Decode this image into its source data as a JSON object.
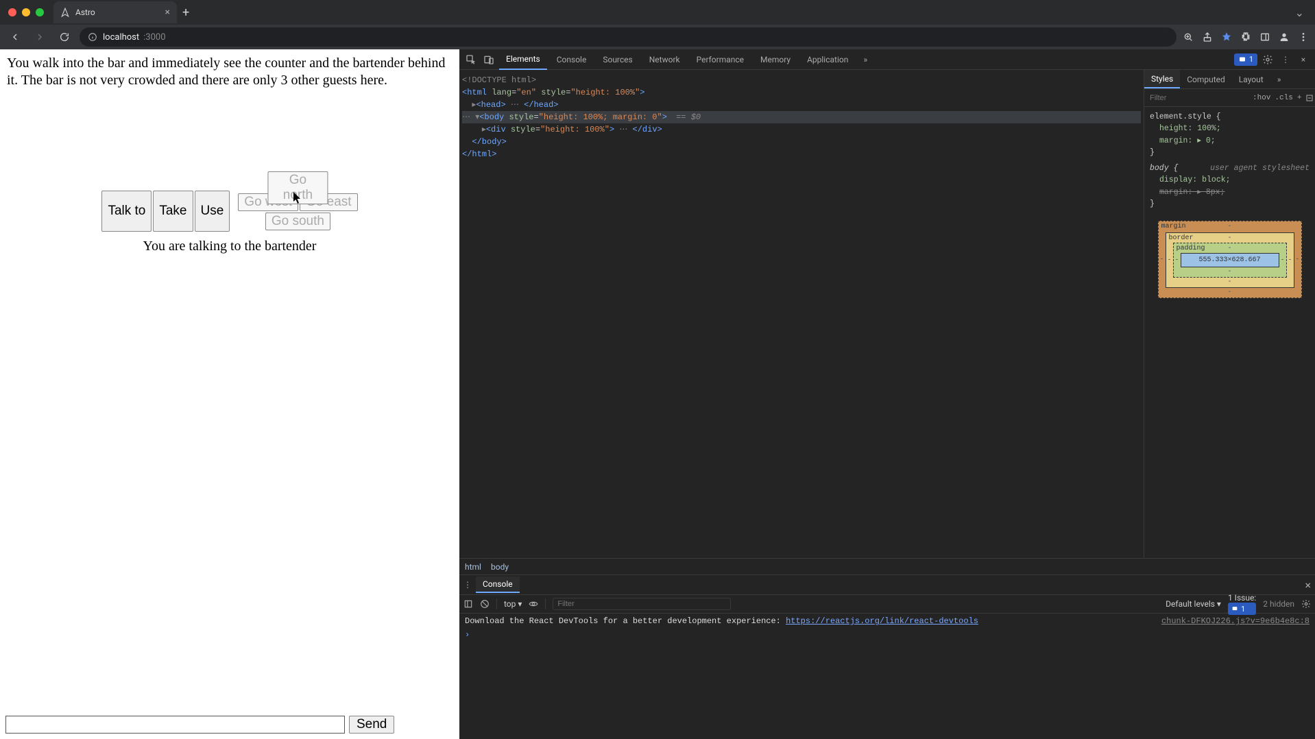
{
  "browser": {
    "tab_title": "Astro",
    "url_host": "localhost",
    "url_rest": ":3000"
  },
  "page": {
    "story_text": "You walk into the bar and immediately see the counter and the bartender behind it. The bar is not very crowded and there are only 3 other guests here.",
    "actions": {
      "talk": "Talk to",
      "take": "Take",
      "use": "Use",
      "north": "Go north",
      "west": "Go west",
      "east": "Go east",
      "south": "Go south"
    },
    "status": "You are talking to the bartender",
    "send": "Send"
  },
  "devtools": {
    "tabs": {
      "elements": "Elements",
      "console": "Console",
      "sources": "Sources",
      "network": "Network",
      "performance": "Performance",
      "memory": "Memory",
      "application": "Application"
    },
    "issue_count": "1",
    "dom": {
      "doctype": "<!DOCTYPE html>",
      "html_open": "<html lang=\"en\" style=\"height: 100%\">",
      "head": "<head> ... </head>",
      "body_open": "<body style=\"height: 100%; margin: 0\"> == $0",
      "div": "<div style=\"height: 100%\"> ... </div>",
      "body_close": "</body>",
      "html_close": "</html>"
    },
    "styles": {
      "tabs": {
        "styles": "Styles",
        "computed": "Computed",
        "layout": "Layout"
      },
      "filter_ph": "Filter",
      "hov": ":hov",
      "cls": ".cls",
      "element_style": "element.style {",
      "rule1_p1": "height: 100%;",
      "rule1_p2": "margin: ▸ 0;",
      "close": "}",
      "body_sel": "body {",
      "ua_label": "user agent stylesheet",
      "rule2_p1": "display: block;",
      "rule2_p2": "margin: ▸ 8px;"
    },
    "boxmodel": {
      "margin": "margin",
      "border": "border",
      "padding": "padding",
      "content": "555.333×628.667"
    },
    "crumbs": {
      "html": "html",
      "body": "body"
    },
    "drawer": {
      "console": "Console",
      "ctx": "top",
      "filter_ph": "Filter",
      "levels": "Default levels",
      "issue_label": "1 Issue:",
      "issue_count": "1",
      "hidden": "2 hidden",
      "log_source": "chunk-DFKOJ226.js?v=9e6b4e8c:8",
      "log_text": "Download the React DevTools for a better development experience: ",
      "log_link": "https://reactjs.org/link/react-devtools"
    }
  }
}
